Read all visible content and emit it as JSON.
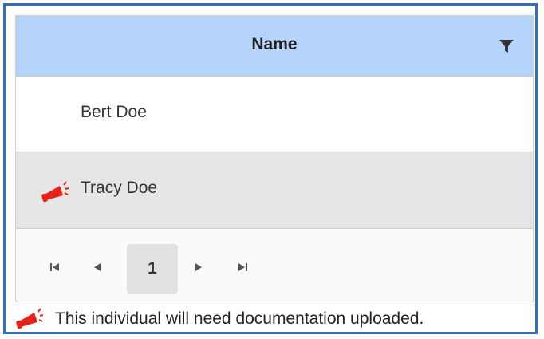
{
  "grid": {
    "header": {
      "name_label": "Name"
    },
    "rows": [
      {
        "name": "Bert Doe",
        "flagged": false
      },
      {
        "name": "Tracy Doe",
        "flagged": true
      }
    ],
    "pager": {
      "current_page": "1"
    }
  },
  "footer": {
    "note": "This individual will need documentation uploaded."
  },
  "colors": {
    "header_bg": "#b6d4fb",
    "flag_red": "#e8221b",
    "frame_blue": "#2f6fc0"
  },
  "icons": {
    "filter": "filter-icon",
    "flag": "megaphone-icon",
    "first": "first-page-icon",
    "prev": "previous-page-icon",
    "next": "next-page-icon",
    "last": "last-page-icon"
  }
}
